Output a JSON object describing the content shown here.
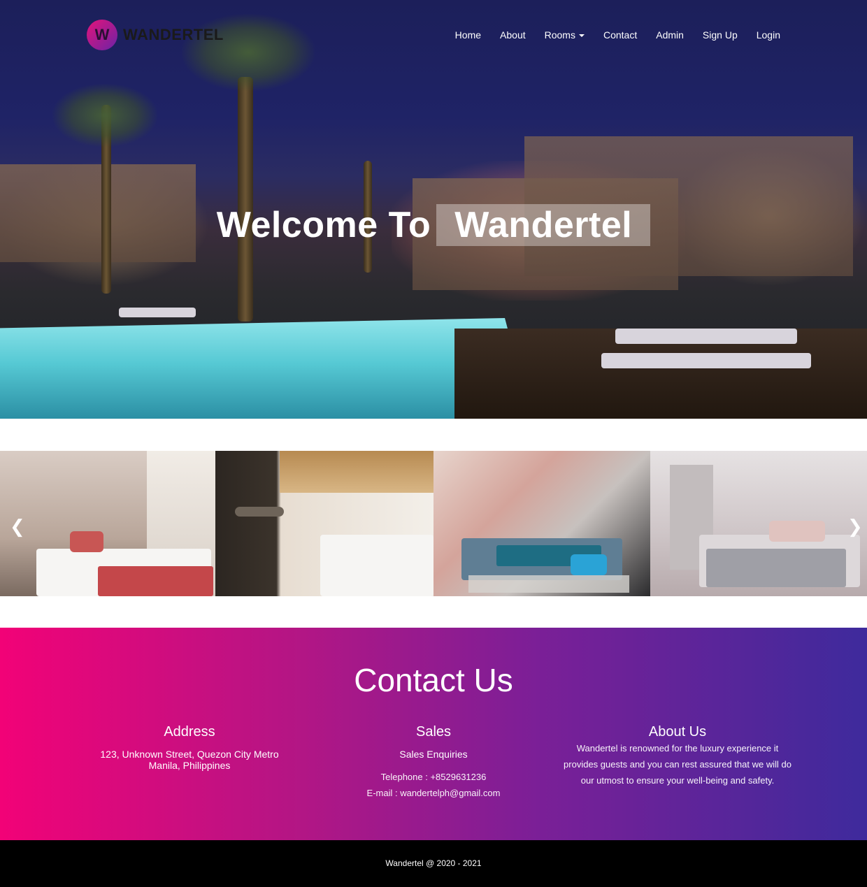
{
  "brand": {
    "logo_letter": "W",
    "name": "WANDERTEL"
  },
  "nav": {
    "items": [
      {
        "label": "Home"
      },
      {
        "label": "About"
      },
      {
        "label": "Rooms"
      },
      {
        "label": "Contact"
      },
      {
        "label": "Admin"
      },
      {
        "label": "Sign Up"
      },
      {
        "label": "Login"
      }
    ]
  },
  "hero": {
    "title_part1": "Welcome To",
    "title_part2": "Wandertel"
  },
  "gallery": {
    "prev_icon": "chevron-left-icon",
    "next_icon": "chevron-right-icon"
  },
  "contact": {
    "heading": "Contact Us",
    "address": {
      "title": "Address",
      "line1": "123, Unknown Street, Quezon City Metro",
      "line2": "Manila, Philippines"
    },
    "sales": {
      "title": "Sales",
      "subtitle": "Sales Enquiries",
      "telephone": "Telephone : +8529631236",
      "email": "E-mail : wandertelph@gmail.com"
    },
    "about": {
      "title": "About Us",
      "text": "Wandertel is renowned for the luxury experience it provides guests and you can rest assured that we will do our utmost to ensure your well-being and safety."
    }
  },
  "footer": {
    "copyright": "Wandertel @ 2020 - 2021"
  },
  "colors": {
    "gradient_start": "#f20277",
    "gradient_end": "#3e2a9c",
    "footer_bg": "#000000"
  }
}
